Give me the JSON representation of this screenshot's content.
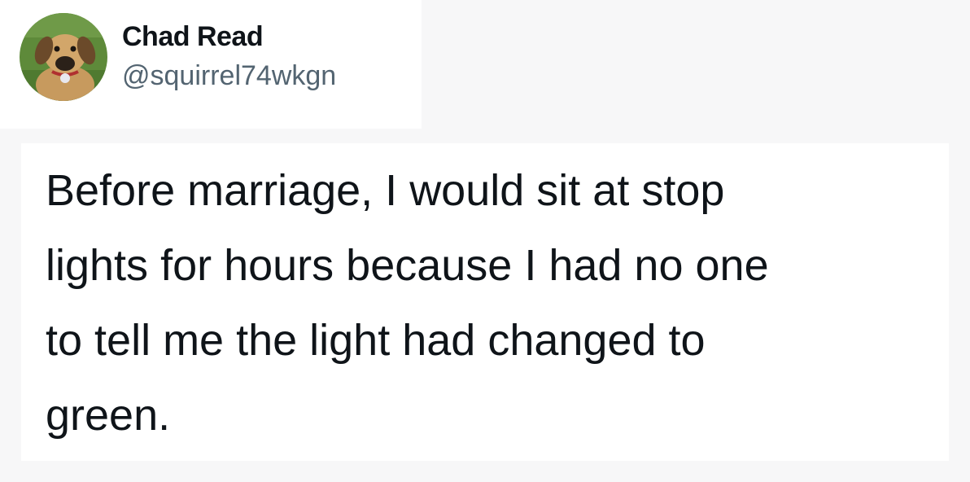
{
  "author": {
    "display_name": "Chad Read",
    "handle": "@squirrel74wkgn",
    "avatar_icon": "dog-avatar-icon"
  },
  "tweet": {
    "lines": [
      "Before marriage, I would sit at stop",
      "lights for hours because I had no one",
      "to tell me the light had changed to",
      "green."
    ]
  }
}
